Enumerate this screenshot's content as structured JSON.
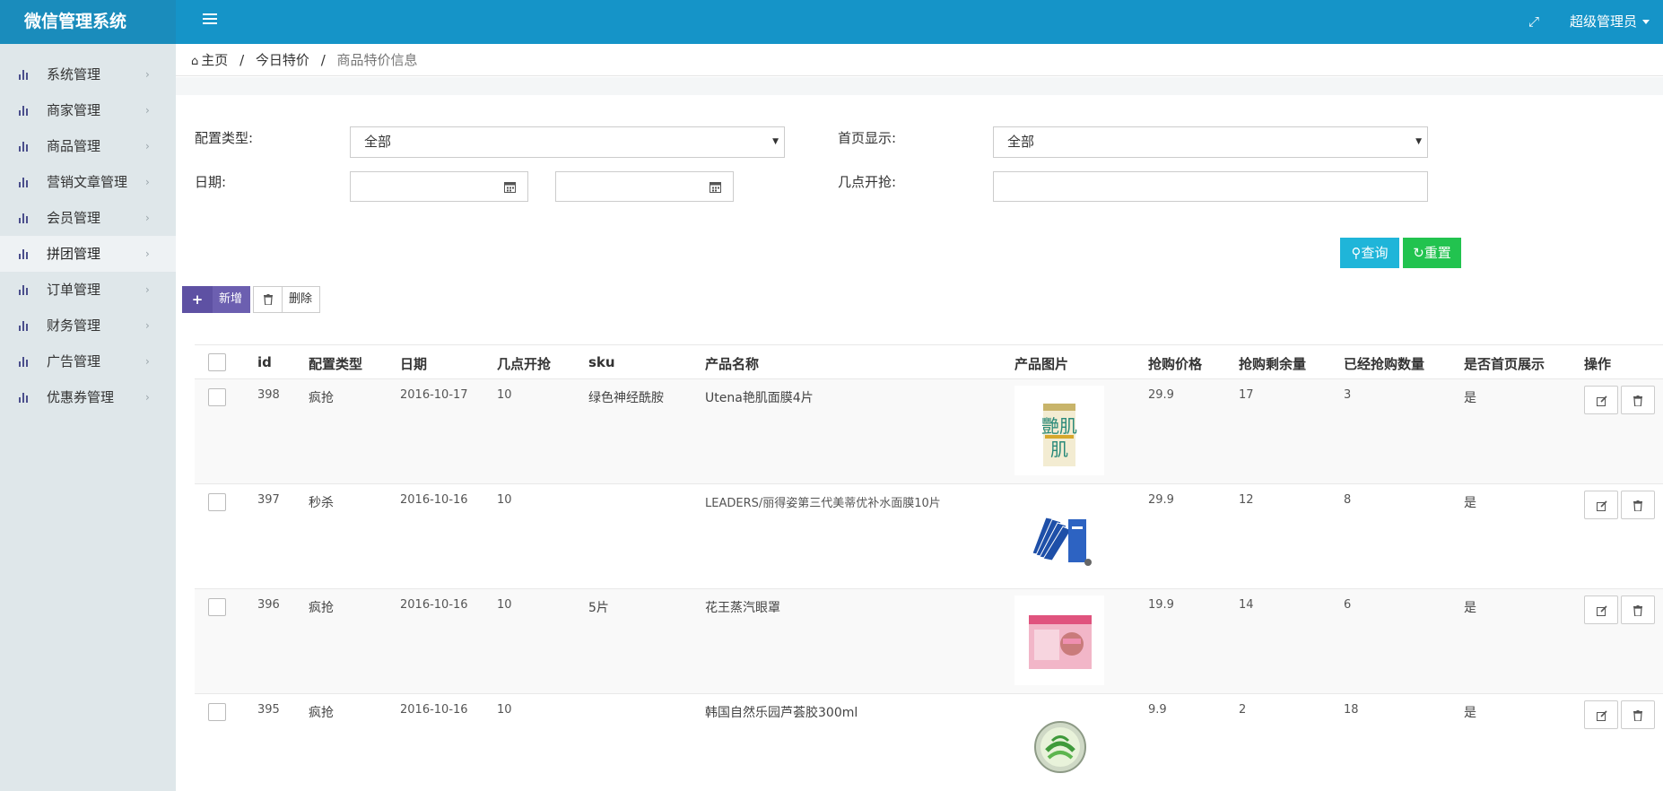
{
  "app": {
    "title": "微信管理系统",
    "user": "超级管理员"
  },
  "sidebar": {
    "items": [
      {
        "label": "系统管理"
      },
      {
        "label": "商家管理"
      },
      {
        "label": "商品管理"
      },
      {
        "label": "营销文章管理"
      },
      {
        "label": "会员管理"
      },
      {
        "label": "拼团管理",
        "active": true
      },
      {
        "label": "订单管理"
      },
      {
        "label": "财务管理"
      },
      {
        "label": "广告管理"
      },
      {
        "label": "优惠券管理"
      }
    ]
  },
  "breadcrumb": {
    "home": "主页",
    "section": "今日特价",
    "current": "商品特价信息"
  },
  "filters": {
    "config_type_label": "配置类型:",
    "config_type_value": "全部",
    "home_display_label": "首页显示:",
    "home_display_value": "全部",
    "date_label": "日期:",
    "start_time_label": "几点开抢:",
    "query_button": "查询",
    "reset_button": "重置"
  },
  "toolbar": {
    "add_label": "新增",
    "delete_label": "删除"
  },
  "table": {
    "columns": [
      "id",
      "配置类型",
      "日期",
      "几点开抢",
      "sku",
      "产品名称",
      "产品图片",
      "抢购价格",
      "抢购剩余量",
      "已经抢购数量",
      "是否首页展示",
      "操作"
    ],
    "rows": [
      {
        "id": "398",
        "type": "疯抢",
        "date": "2016-10-17",
        "hour": "10",
        "sku": "绿色神经酰胺",
        "name": "Utena艳肌面膜4片",
        "price": "29.9",
        "remaining": "17",
        "sold": "3",
        "home": "是",
        "image": "艷肌"
      },
      {
        "id": "397",
        "type": "秒杀",
        "date": "2016-10-16",
        "hour": "10",
        "sku": "",
        "name": "LEADERS/丽得姿第三代美蒂优补水面膜10片",
        "price": "29.9",
        "remaining": "12",
        "sold": "8",
        "home": "是",
        "image": ""
      },
      {
        "id": "396",
        "type": "疯抢",
        "date": "2016-10-16",
        "hour": "10",
        "sku": "5片",
        "name": "花王蒸汽眼罩",
        "price": "19.9",
        "remaining": "14",
        "sold": "6",
        "home": "是",
        "image": ""
      },
      {
        "id": "395",
        "type": "疯抢",
        "date": "2016-10-16",
        "hour": "10",
        "sku": "",
        "name": "韩国自然乐园芦荟胶300ml",
        "price": "9.9",
        "remaining": "2",
        "sold": "18",
        "home": "是",
        "image": ""
      }
    ]
  }
}
